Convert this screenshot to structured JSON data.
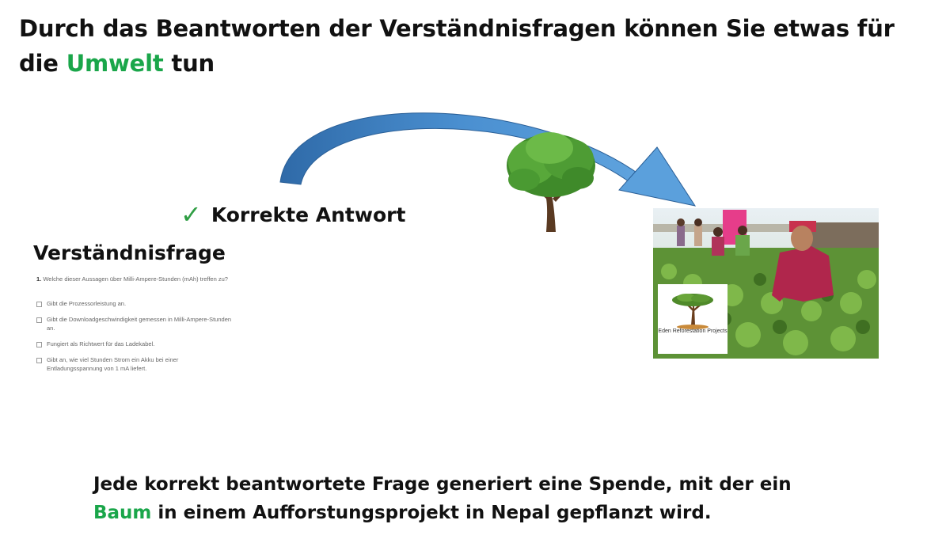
{
  "headline": {
    "part1": "Durch das Beantworten der Verständnisfragen können Sie etwas für die",
    "highlight": "Umwelt",
    "part2": "tun"
  },
  "correct": {
    "check": "✓",
    "label": "Korrekte Antwort"
  },
  "question": {
    "heading": "Verständnisfrage",
    "number": "1.",
    "text": "Welche dieser Aussagen über Milli-Ampere-Stunden (mAh) treffen zu?",
    "options": [
      "Gibt die Prozessorleistung an.",
      "Gibt die Downloadgeschwindigkeit gemessen in Milli-Ampere-Stunden an.",
      "Fungiert als Richtwert für das Ladekabel.",
      "Gibt an, wie viel Stunden Strom ein Akku bei einer Entladungsspannung von 1 mA liefert."
    ]
  },
  "photo": {
    "logo_text": "Eden Reforestation Projects"
  },
  "footer": {
    "part1": "Jede korrekt beantwortete Frage generiert eine Spende, mit der ein",
    "highlight": "Baum",
    "part2": "in einem Aufforstungsprojekt in Nepal gepflanzt wird."
  },
  "colors": {
    "accent_green": "#1aa64a",
    "arrow_blue": "#3e7fc1",
    "check_green": "#2f9e44"
  }
}
